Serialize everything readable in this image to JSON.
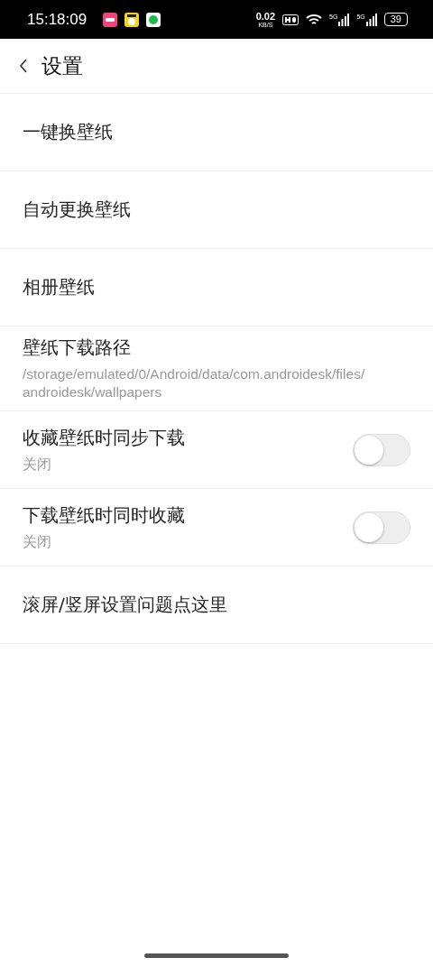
{
  "status_bar": {
    "time": "15:18:09",
    "speed_value": "0.02",
    "speed_unit": "KB/S",
    "signals": [
      {
        "label": "5G"
      },
      {
        "label": "5G"
      }
    ],
    "battery": "39"
  },
  "header": {
    "title": "设置"
  },
  "items": [
    {
      "kind": "plain",
      "title": "一键换壁纸"
    },
    {
      "kind": "plain",
      "title": "自动更换壁纸"
    },
    {
      "kind": "plain",
      "title": "相册壁纸"
    },
    {
      "kind": "path",
      "title": "壁纸下载路径",
      "subtitle": "/storage/emulated/0/Android/data/com.androidesk/files/androidesk/wallpapers"
    },
    {
      "kind": "toggle",
      "title": "收藏壁纸时同步下载",
      "subtitle": "关闭",
      "on": false
    },
    {
      "kind": "toggle",
      "title": "下载壁纸时同时收藏",
      "subtitle": "关闭",
      "on": false
    },
    {
      "kind": "plain",
      "title": "滚屏/竖屏设置问题点这里"
    }
  ]
}
